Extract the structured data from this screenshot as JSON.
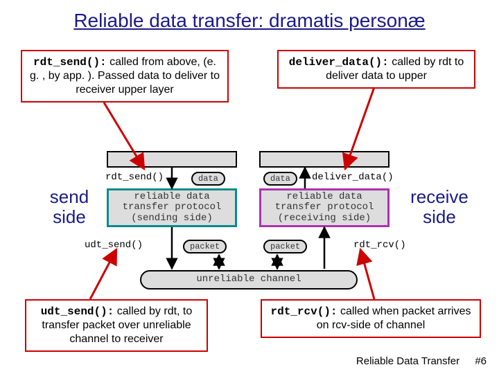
{
  "title": "Reliable data transfer: dramatis personæ",
  "callouts": {
    "rdt_send": {
      "code": "rdt_send():",
      "text": " called from above, (e. g. , by app. ). Passed data to deliver to receiver upper layer"
    },
    "deliver_data": {
      "code": "deliver_data():",
      "text": " called by rdt to deliver data to upper"
    },
    "udt_send": {
      "code": "udt_send():",
      "text": " called by rdt, to transfer packet over unreliable channel to receiver"
    },
    "rdt_rcv": {
      "code": "rdt_rcv():",
      "text": " called when packet arrives on rcv-side of channel"
    }
  },
  "side_labels": {
    "send": "send side",
    "receive": "receive side"
  },
  "diagram": {
    "rdt_send_label": "rdt_send()",
    "deliver_data_label": "deliver_data()",
    "udt_send_label": "udt_send()",
    "rdt_rcv_label": "rdt_rcv()",
    "data_pill": "data",
    "packet_pill": "packet",
    "send_box": "reliable data transfer protocol (sending side)",
    "recv_box": "reliable data transfer protocol (receiving side)",
    "channel": "unreliable channel"
  },
  "footer": {
    "topic": "Reliable Data Transfer",
    "page": "#6"
  }
}
